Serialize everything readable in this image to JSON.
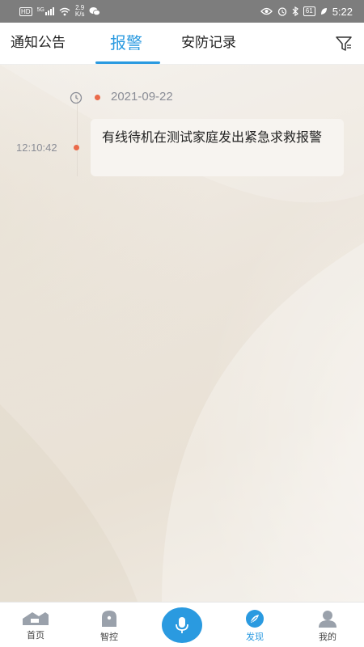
{
  "status_bar": {
    "network_badge": "HD",
    "signal_label": "5G",
    "speed_value": "2.9",
    "speed_unit": "K/s",
    "battery": "61",
    "time": "5:22"
  },
  "tabs": [
    {
      "label": "通知公告",
      "active": false
    },
    {
      "label": "报警",
      "active": true
    },
    {
      "label": "安防记录",
      "active": false
    }
  ],
  "timeline": {
    "date": "2021-09-22",
    "entries": [
      {
        "time": "12:10:42",
        "message": "有线待机在测试家庭发出紧急求救报警"
      }
    ]
  },
  "bottom_nav": [
    {
      "label": "首页",
      "icon": "home-icon",
      "active": false
    },
    {
      "label": "智控",
      "icon": "smart-control-icon",
      "active": false
    },
    {
      "label": "",
      "icon": "microphone-icon",
      "active": false
    },
    {
      "label": "发现",
      "icon": "discover-icon",
      "active": true
    },
    {
      "label": "我的",
      "icon": "profile-icon",
      "active": false
    }
  ],
  "colors": {
    "accent": "#2a9ae0",
    "alert_dot": "#ea6a4a",
    "status_bar": "#7d7d7d"
  }
}
